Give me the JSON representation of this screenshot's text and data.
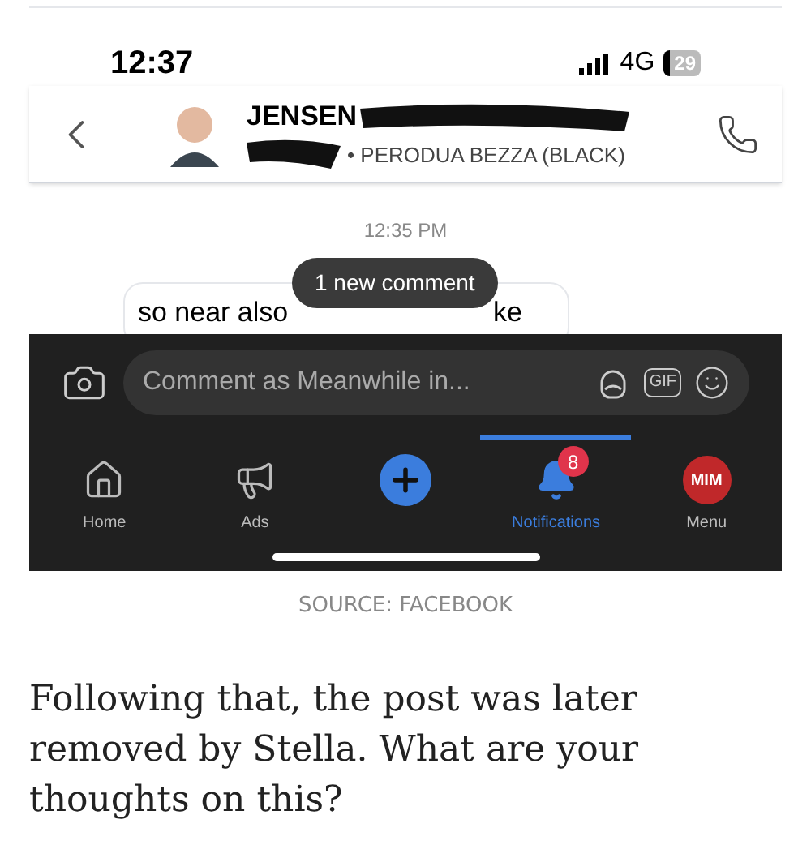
{
  "phone": {
    "time": "12:37",
    "network": "4G",
    "battery": "29",
    "chat_header": {
      "name": "JENSEN",
      "subtitle": "• PERODUA BEZZA (BLACK)"
    },
    "timestamp": "12:35 PM",
    "message": {
      "text_before": "so near also",
      "text_after": "ke"
    },
    "toast": "1 new comment",
    "comment_field": {
      "placeholder": "Comment as Meanwhile in...",
      "gif": "GIF"
    },
    "nav": [
      {
        "kind": "home",
        "label": "Home",
        "selected": false
      },
      {
        "kind": "ads",
        "label": "Ads",
        "selected": false
      },
      {
        "kind": "create",
        "selected": false
      },
      {
        "kind": "notifications",
        "label": "Notifications",
        "selected": true,
        "badge": "8"
      },
      {
        "kind": "menu",
        "label": "Menu",
        "selected": false,
        "avatar_text": "MIM"
      }
    ]
  },
  "caption": "SOURCE: FACEBOOK",
  "paragraph": "Following that, the post was later removed by Stella. What are your thoughts on this?"
}
